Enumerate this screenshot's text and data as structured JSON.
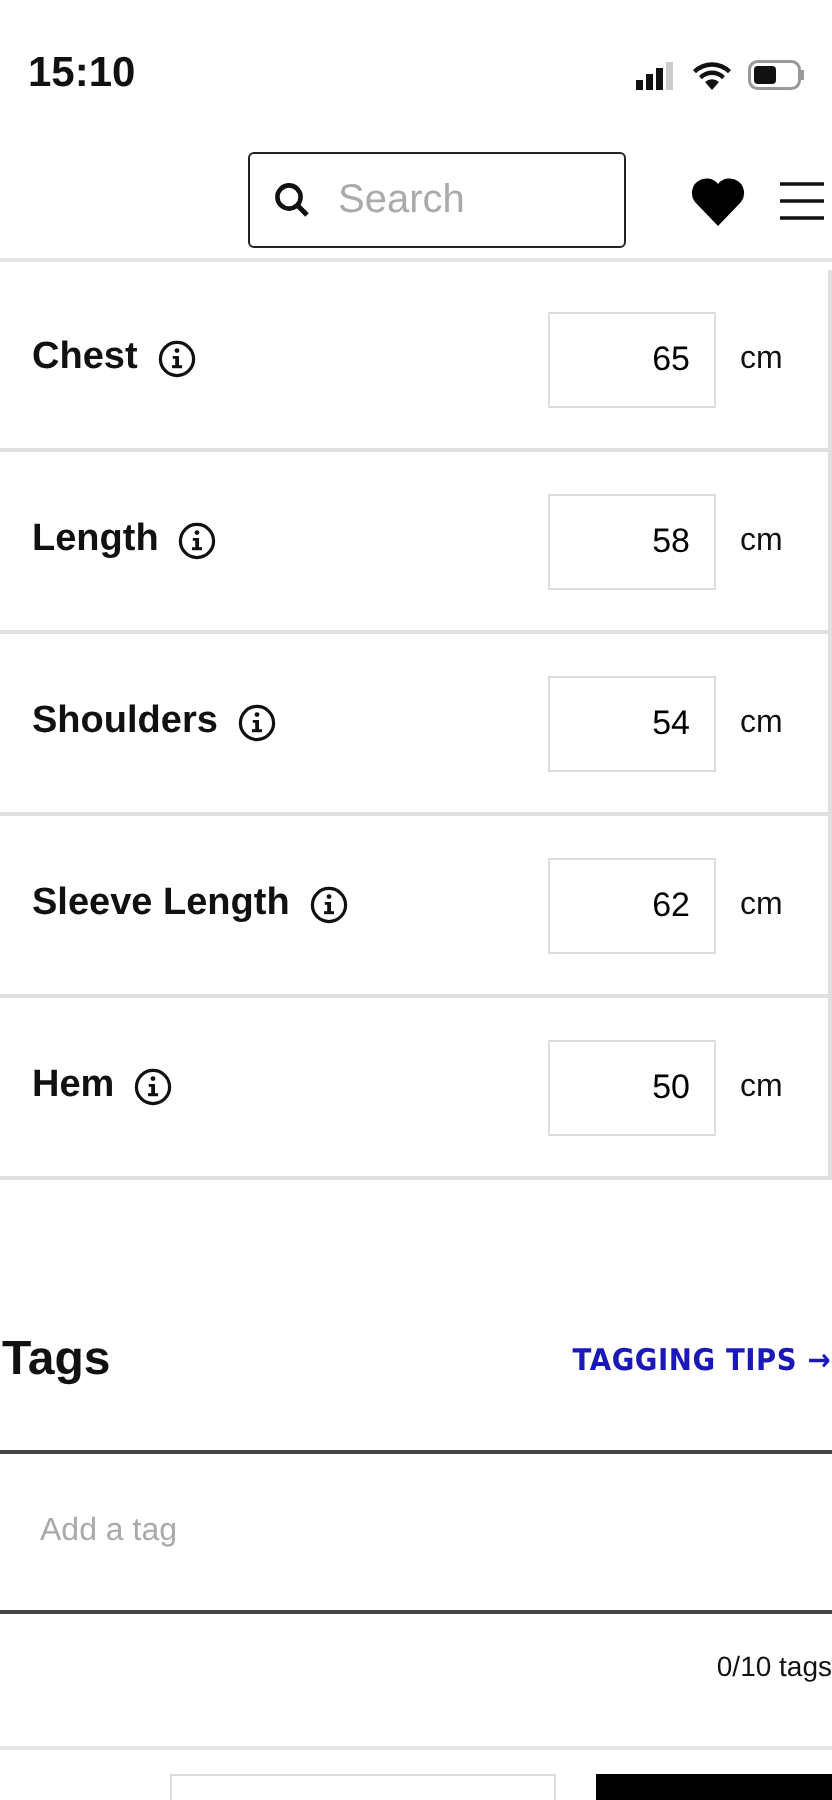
{
  "status_bar": {
    "time": "15:10"
  },
  "header": {
    "search": {
      "placeholder": "Search"
    }
  },
  "measurements": [
    {
      "label": "Chest",
      "value": "65",
      "unit": "cm"
    },
    {
      "label": "Length",
      "value": "58",
      "unit": "cm"
    },
    {
      "label": "Shoulders",
      "value": "54",
      "unit": "cm"
    },
    {
      "label": "Sleeve Length",
      "value": "62",
      "unit": "cm"
    },
    {
      "label": "Hem",
      "value": "50",
      "unit": "cm"
    }
  ],
  "tags": {
    "title": "Tags",
    "tips_link": "TAGGING TIPS →",
    "input": {
      "placeholder": "Add a tag"
    },
    "count": "0/10 tags"
  }
}
